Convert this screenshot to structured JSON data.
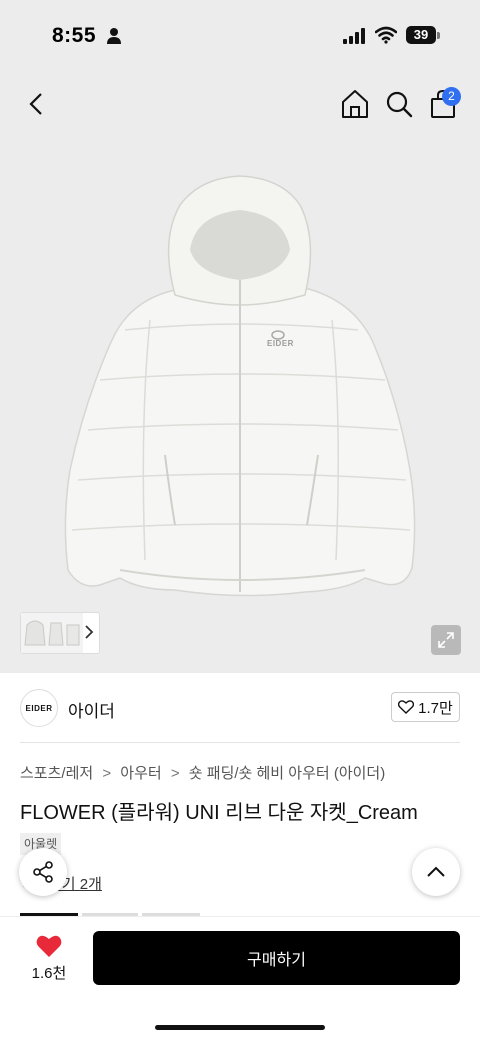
{
  "status": {
    "time": "8:55",
    "battery": "39"
  },
  "header": {
    "cart_count": "2"
  },
  "brand": {
    "logo_text": "EIDER",
    "name": "아이더",
    "likes": "1.7만"
  },
  "breadcrumb": {
    "items": [
      "스포츠/레저",
      "아우터",
      "숏 패딩/숏 헤비 아우터 (아이더)"
    ]
  },
  "product": {
    "title": "FLOWER (플라워) UNI 리브 다운 자켓_Cream",
    "tag": "아울렛",
    "review_link": "후기 2개",
    "jacket_logo": "EIDER"
  },
  "bottom": {
    "wish_count": "1.6천",
    "buy_label": "구매하기"
  },
  "colors": {
    "accent": "#2f6ff0",
    "heart": "#e8293a",
    "buy_bg": "#000000",
    "hero_bg": "#ececec"
  }
}
